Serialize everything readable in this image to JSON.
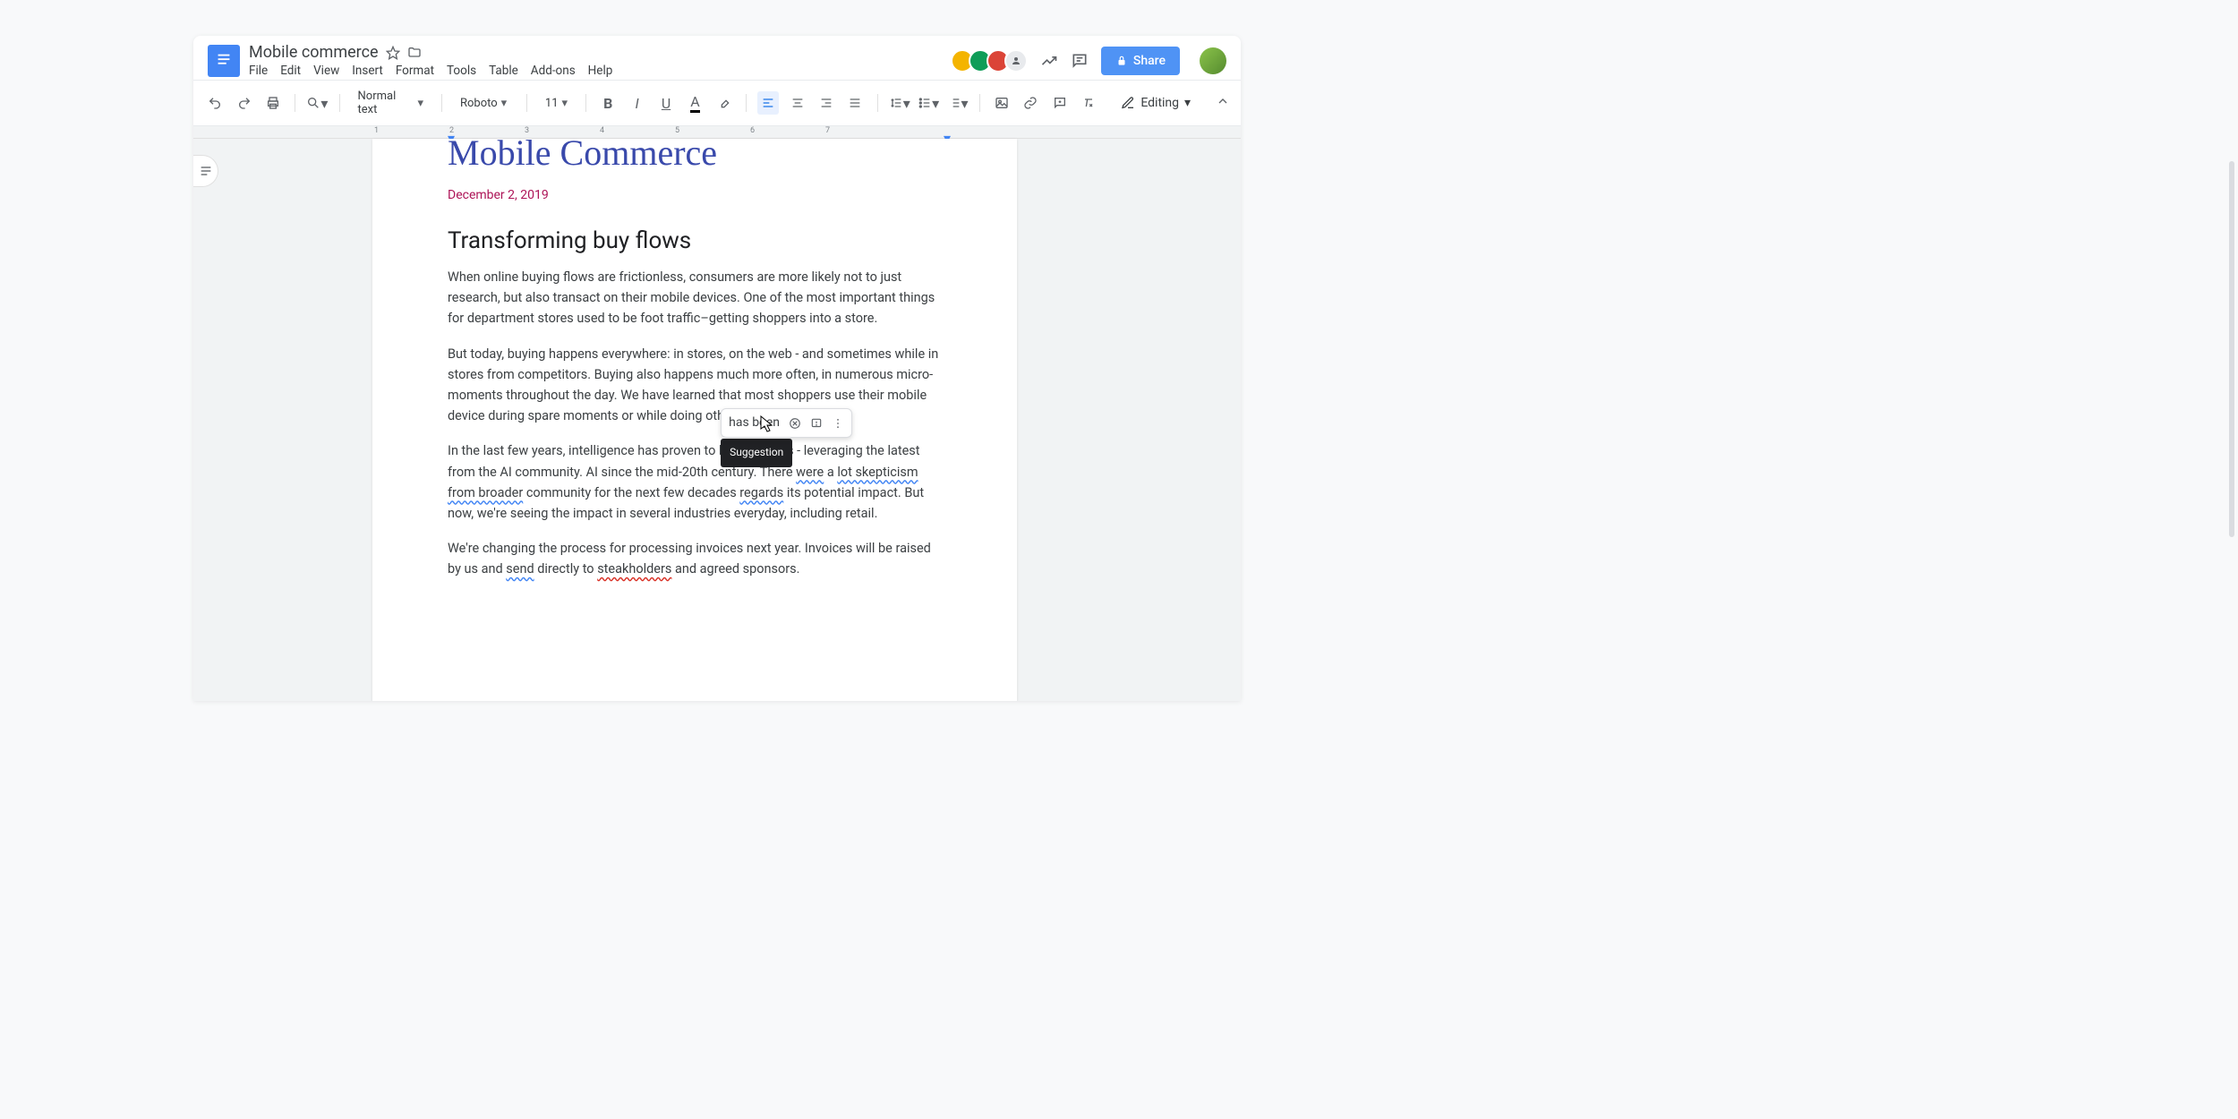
{
  "header": {
    "doc_title": "Mobile commerce",
    "menus": [
      "File",
      "Edit",
      "View",
      "Insert",
      "Format",
      "Tools",
      "Table",
      "Add-ons",
      "Help"
    ],
    "share_label": "Share"
  },
  "toolbar": {
    "style_select": "Normal text",
    "font_select": "Roboto",
    "font_size": "11",
    "mode_label": "Editing"
  },
  "ruler": {
    "marks": [
      "1",
      "2",
      "3",
      "4",
      "5",
      "6",
      "7"
    ]
  },
  "document": {
    "title": "Mobile Commerce",
    "date": "December 2, 2019",
    "heading": "Transforming buy flows",
    "p1": "When online buying flows are frictionless, consumers are more likely not to  just research, but also transact on their mobile devices. One of the most important things for department stores used to be foot traffic–getting shoppers into a store.",
    "p2": "But today, buying happens everywhere: in stores, on the web - and sometimes while in stores from competitors. Buying also happens much more often, in numerous micro-moments throughout the day. We have learned that most shoppers use their mobile device during spare moments or while doing other activities.",
    "p3_a": "In the last few years, intelligence has proven to b",
    "p3_hidden": "",
    "p3_b": "t purchases - leveraging the latest from the AI community. AI ",
    "p3_hidden2": "",
    "p3_c": " since the mid-20th century. There ",
    "p3_were": "were",
    "p3_d": " a ",
    "p3_lot": "lot skepticism",
    "p3_e": " ",
    "p3_from": "from broader",
    "p3_f": " community for the next few decades ",
    "p3_regards": "regards",
    "p3_g": " its potential impact. But now, we're seeing the impact in several industries everyday, including retail.",
    "p4_a": "We're changing the process for processing invoices next year. Invoices will be raised by us and ",
    "p4_send": "send",
    "p4_b": " directly to ",
    "p4_steak": "steakholders",
    "p4_c": " and agreed sponsors."
  },
  "suggestion": {
    "text": "has be̤en",
    "tooltip": "Suggestion"
  }
}
